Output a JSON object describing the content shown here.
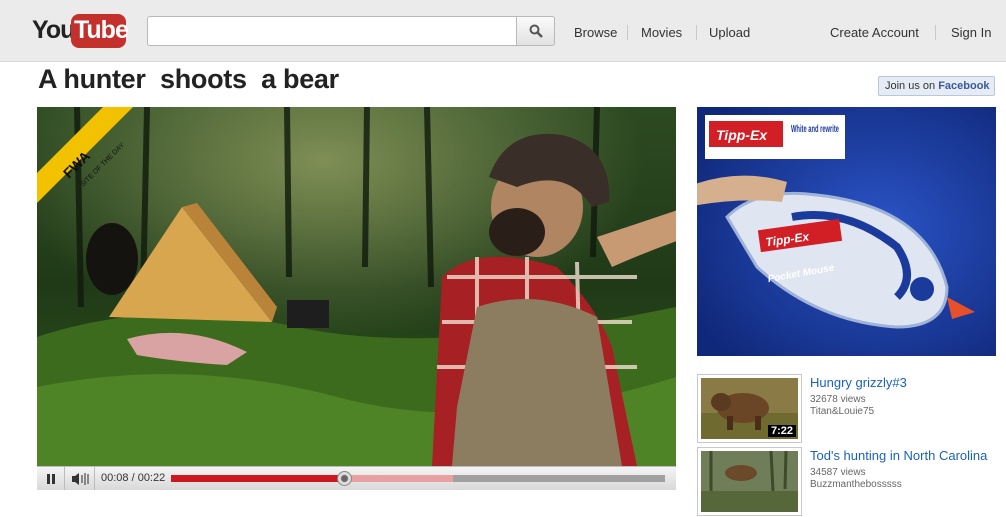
{
  "masthead": {
    "logo_you": "You",
    "logo_tube": "Tube",
    "search": {
      "value": "",
      "placeholder": ""
    },
    "nav": {
      "browse": "Browse",
      "movies": "Movies",
      "upload": "Upload",
      "create_account": "Create Account",
      "sign_in": "Sign In"
    }
  },
  "video": {
    "title": "A hunter  shoots  a bear",
    "badge_logo": "FWA",
    "badge_text": "SITE OF THE DAY",
    "time": "00:08 / 00:22",
    "played_fraction": 0.35,
    "loaded_fraction": 0.57
  },
  "facebook": {
    "prefix": "Join us on ",
    "brand": "Facebook"
  },
  "ad": {
    "brand": "Tipp-Ex",
    "tagline": "White and rewrite",
    "product_brand": "Tipp-Ex",
    "product_name": "Pocket Mouse"
  },
  "related": [
    {
      "title": "Hungry grizzly#3",
      "views": "32678 views",
      "user": "Titan&Louie75",
      "duration": "7:22"
    },
    {
      "title": "Tod's hunting in North Carolina",
      "views": "34587 views",
      "user": "Buzzmanthebosssss",
      "duration": ""
    }
  ],
  "colors": {
    "brand_red": "#c4302b",
    "progress_played": "#cc181e",
    "link_blue": "#1c62b9",
    "facebook_blue": "#3b5998",
    "ad_blue": "#1a3a9c"
  }
}
